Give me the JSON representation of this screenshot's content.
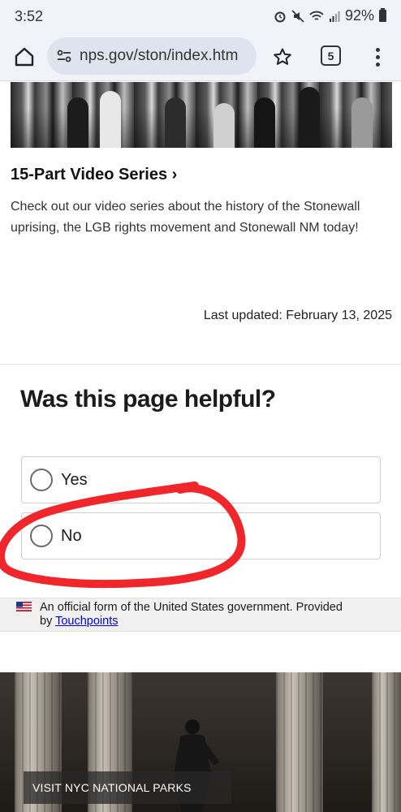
{
  "status_bar": {
    "time": "3:52",
    "battery": "92%"
  },
  "browser": {
    "url": "nps.gov/ston/index.htm",
    "tab_count": "5"
  },
  "content": {
    "video_link": "15-Part Video Series ›",
    "video_description": "Check out our video series about the history of the Stonewall uprising, the LGB rights movement and Stonewall NM today!",
    "last_updated": "Last updated: February 13, 2025"
  },
  "feedback": {
    "title": "Was this page helpful?",
    "options": [
      {
        "label": "Yes"
      },
      {
        "label": "No"
      }
    ],
    "official_text": "An official form of the United States government. Provided",
    "official_by": "by",
    "official_link": "Touchpoints"
  },
  "banner": {
    "visit": "VISIT NYC NATIONAL PARKS"
  },
  "colors": {
    "annotation_circle": "#f0262a",
    "link": "#005ea2"
  }
}
